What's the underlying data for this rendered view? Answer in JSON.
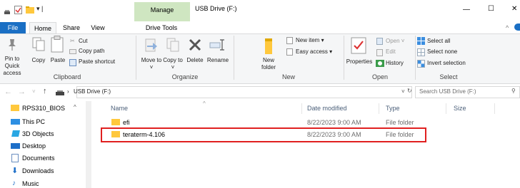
{
  "window": {
    "title": "USB Drive (F:)",
    "manage_label": "Manage",
    "drive_tools_label": "Drive Tools",
    "controls": {
      "minimize": "—",
      "maximize": "☐",
      "close": "✕"
    }
  },
  "ribbon": {
    "tabs": [
      "File",
      "Home",
      "Share",
      "View"
    ],
    "clipboard": {
      "pin_label": "Pin to Quick access",
      "copy_label": "Copy",
      "paste_label": "Paste",
      "cut_label": "Cut",
      "copy_path_label": "Copy path",
      "paste_shortcut_label": "Paste shortcut",
      "group_label": "Clipboard"
    },
    "organize": {
      "move_to_label": "Move to ˅",
      "copy_to_label": "Copy to ˅",
      "delete_label": "Delete",
      "rename_label": "Rename",
      "group_label": "Organize"
    },
    "new": {
      "new_folder_label": "New folder",
      "new_item_label": "New item ▾",
      "easy_access_label": "Easy access ▾",
      "group_label": "New"
    },
    "open": {
      "properties_label": "Properties",
      "open_label": "Open ˅",
      "edit_label": "Edit",
      "history_label": "History",
      "group_label": "Open"
    },
    "select": {
      "select_all_label": "Select all",
      "select_none_label": "Select none",
      "invert_label": "Invert selection",
      "group_label": "Select"
    }
  },
  "address": {
    "path_separator": "›",
    "path": "USB Drive (F:)",
    "search_placeholder": "Search USB Drive (F:)"
  },
  "nav": {
    "items": [
      {
        "label": "RPS310_BIOS",
        "icon": "folder-icon"
      },
      {
        "label": "This PC",
        "icon": "computer-icon"
      },
      {
        "label": "3D Objects",
        "icon": "cube-icon"
      },
      {
        "label": "Desktop",
        "icon": "desktop-icon"
      },
      {
        "label": "Documents",
        "icon": "document-icon"
      },
      {
        "label": "Downloads",
        "icon": "download-icon"
      },
      {
        "label": "Music",
        "icon": "music-icon"
      }
    ]
  },
  "file_list": {
    "columns": [
      "Name",
      "Date modified",
      "Type",
      "Size"
    ],
    "rows": [
      {
        "name": "efi",
        "date": "8/22/2023 9:00 AM",
        "type": "File folder",
        "size": ""
      },
      {
        "name": "teraterm-4.106",
        "date": "8/22/2023 9:00 AM",
        "type": "File folder",
        "size": ""
      }
    ]
  },
  "colors": {
    "file_tab": "#1a6fc4",
    "manage_tab": "#cfe6c1",
    "folder": "#ffc83d",
    "highlight_box": "#e02020",
    "column_header_text": "#4c607a"
  }
}
